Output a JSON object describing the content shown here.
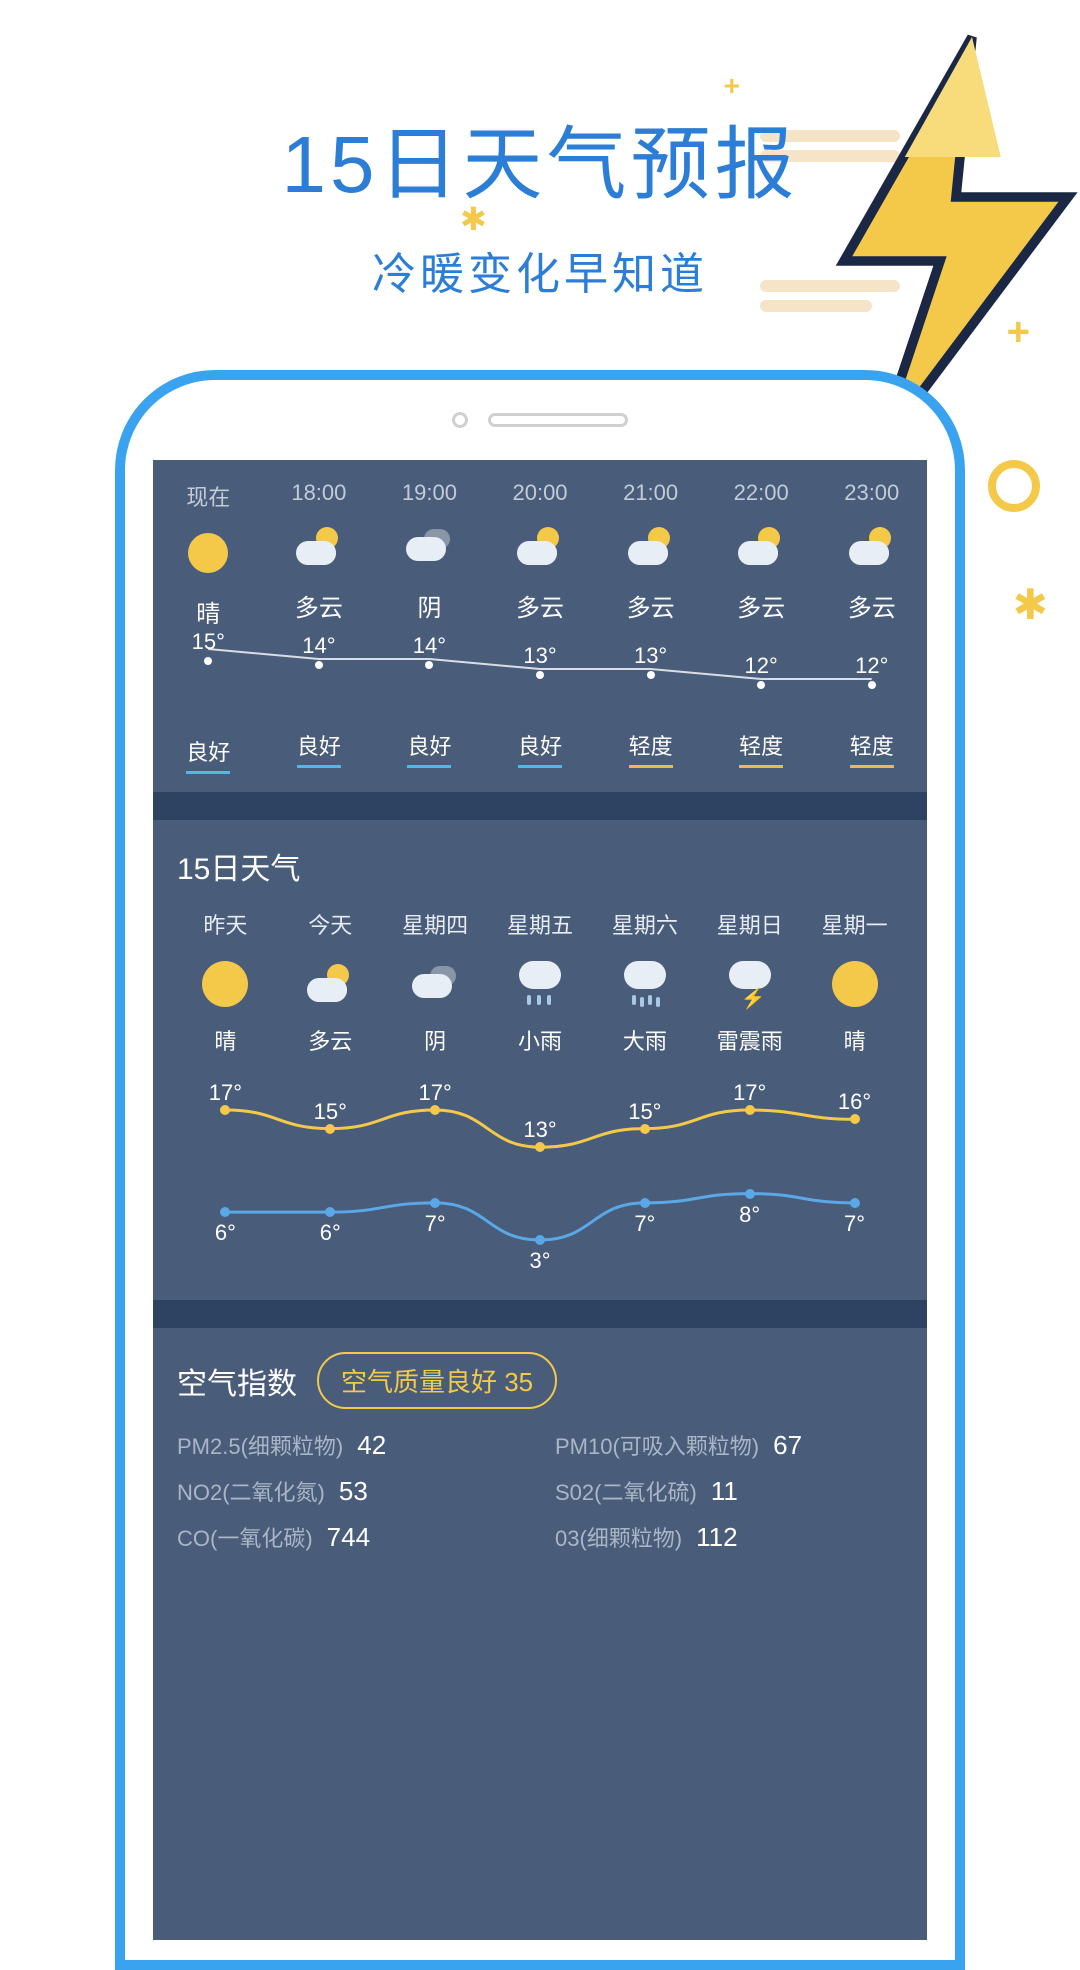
{
  "header": {
    "title": "15日天气预报",
    "subtitle": "冷暖变化早知道"
  },
  "hourly": {
    "items": [
      {
        "time": "现在",
        "icon": "sun",
        "condition": "晴",
        "temp": "15°",
        "aqi": "良好",
        "aqi_level": "good"
      },
      {
        "time": "18:00",
        "icon": "cloud-sun",
        "condition": "多云",
        "temp": "14°",
        "aqi": "良好",
        "aqi_level": "good"
      },
      {
        "time": "19:00",
        "icon": "overcast",
        "condition": "阴",
        "temp": "14°",
        "aqi": "良好",
        "aqi_level": "good"
      },
      {
        "time": "20:00",
        "icon": "cloud-sun",
        "condition": "多云",
        "temp": "13°",
        "aqi": "良好",
        "aqi_level": "good"
      },
      {
        "time": "21:00",
        "icon": "cloud-sun",
        "condition": "多云",
        "temp": "13°",
        "aqi": "轻度",
        "aqi_level": "mild"
      },
      {
        "time": "22:00",
        "icon": "cloud-sun",
        "condition": "多云",
        "temp": "12°",
        "aqi": "轻度",
        "aqi_level": "mild"
      },
      {
        "time": "23:00",
        "icon": "cloud-sun",
        "condition": "多云",
        "temp": "12°",
        "aqi": "轻度",
        "aqi_level": "mild"
      }
    ]
  },
  "daily": {
    "title": "15日天气",
    "days": [
      {
        "label": "昨天",
        "icon": "sun",
        "condition": "晴",
        "hi": "17°",
        "lo": "6°"
      },
      {
        "label": "今天",
        "icon": "cloud-sun",
        "condition": "多云",
        "hi": "15°",
        "lo": "6°"
      },
      {
        "label": "星期四",
        "icon": "overcast",
        "condition": "阴",
        "hi": "17°",
        "lo": "7°"
      },
      {
        "label": "星期五",
        "icon": "rain",
        "condition": "小雨",
        "hi": "13°",
        "lo": "3°"
      },
      {
        "label": "星期六",
        "icon": "rain-heavy",
        "condition": "大雨",
        "hi": "15°",
        "lo": "7°"
      },
      {
        "label": "星期日",
        "icon": "storm",
        "condition": "雷震雨",
        "hi": "17°",
        "lo": "8°"
      },
      {
        "label": "星期一",
        "icon": "sun",
        "condition": "晴",
        "hi": "16°",
        "lo": "7°"
      }
    ]
  },
  "air": {
    "title": "空气指数",
    "badge": "空气质量良好 35",
    "items": [
      {
        "label": "PM2.5(细颗粒物)",
        "value": "42"
      },
      {
        "label": "PM10(可吸入颗粒物)",
        "value": "67"
      },
      {
        "label": "NO2(二氧化氮)",
        "value": "53"
      },
      {
        "label": "S02(二氧化硫)",
        "value": "11"
      },
      {
        "label": "CO(一氧化碳)",
        "value": "744"
      },
      {
        "label": "03(细颗粒物)",
        "value": "112"
      }
    ]
  },
  "chart_data": {
    "type": "line",
    "hourly": {
      "x": [
        "现在",
        "18:00",
        "19:00",
        "20:00",
        "21:00",
        "22:00",
        "23:00"
      ],
      "temp": [
        15,
        14,
        14,
        13,
        13,
        12,
        12
      ]
    },
    "daily": {
      "x": [
        "昨天",
        "今天",
        "星期四",
        "星期五",
        "星期六",
        "星期日",
        "星期一"
      ],
      "series": [
        {
          "name": "high",
          "values": [
            17,
            15,
            17,
            13,
            15,
            17,
            16
          ],
          "color": "#f4c94a"
        },
        {
          "name": "low",
          "values": [
            6,
            6,
            7,
            3,
            7,
            8,
            7
          ],
          "color": "#5ba8e8"
        }
      ],
      "ylim": [
        3,
        17
      ]
    }
  }
}
